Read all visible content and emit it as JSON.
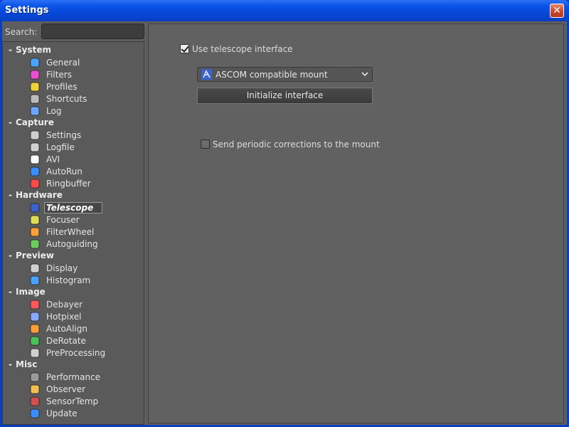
{
  "window": {
    "title": "Settings",
    "close_glyph": "✕"
  },
  "search": {
    "label": "Search:",
    "placeholder": "",
    "value": ""
  },
  "tree": {
    "groups": [
      {
        "label": "System",
        "items": [
          "General",
          "Filters",
          "Profiles",
          "Shortcuts",
          "Log"
        ]
      },
      {
        "label": "Capture",
        "items": [
          "Settings",
          "Logfile",
          "AVI",
          "AutoRun",
          "Ringbuffer"
        ]
      },
      {
        "label": "Hardware",
        "items": [
          "Telescope",
          "Focuser",
          "FilterWheel",
          "Autoguiding"
        ]
      },
      {
        "label": "Preview",
        "items": [
          "Display",
          "Histogram"
        ]
      },
      {
        "label": "Image",
        "items": [
          "Debayer",
          "Hotpixel",
          "AutoAlign",
          "DeRotate",
          "PreProcessing"
        ]
      },
      {
        "label": "Misc",
        "items": [
          "Performance",
          "Observer",
          "SensorTemp",
          "Update"
        ]
      }
    ],
    "collapse_glyph": "-",
    "selected": "Telescope"
  },
  "panel": {
    "use_interface": {
      "label": "Use telescope interface",
      "checked": true
    },
    "mount_select": {
      "value": "ASCOM compatible mount"
    },
    "init_button": {
      "label": "Initialize interface"
    },
    "periodic": {
      "label": "Send periodic corrections to the mount",
      "checked": false
    }
  },
  "colors": {
    "titlebar": "#0a52e6",
    "panel_bg": "#616161",
    "close": "#c7442a"
  }
}
